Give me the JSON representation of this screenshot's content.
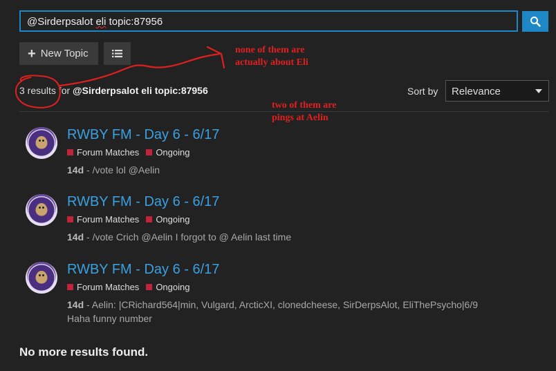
{
  "search": {
    "value_before": "@Sirderpsalot ",
    "value_squiggle": "eli",
    "value_after": " topic:87956",
    "button_icon": "search-icon"
  },
  "toolbar": {
    "new_topic_label": "New Topic",
    "new_topic_icon": "plus-icon",
    "list_icon": "list-icon"
  },
  "results": {
    "count_text": "3 results for",
    "query": "@Sirderpsalot eli topic:87956"
  },
  "sort": {
    "label": "Sort by",
    "selected": "Relevance"
  },
  "items": [
    {
      "title": "RWBY FM - Day 6 - 6/17",
      "categories": [
        "Forum Matches",
        "Ongoing"
      ],
      "date": "14d",
      "blurb_line1": "/vote lol @Aelin",
      "blurb_line2": ""
    },
    {
      "title": "RWBY FM - Day 6 - 6/17",
      "categories": [
        "Forum Matches",
        "Ongoing"
      ],
      "date": "14d",
      "blurb_line1": "/vote Crich @Aelin I forgot to @ Aelin last time",
      "blurb_line2": ""
    },
    {
      "title": "RWBY FM - Day 6 - 6/17",
      "categories": [
        "Forum Matches",
        "Ongoing"
      ],
      "date": "14d",
      "blurb_line1": "Aelin: |CRichard564|min, Vulgard, ArcticXI, clonedcheese, SirDerpsAlot, EliThePsycho|6/9",
      "blurb_line2": "Haha funny number"
    }
  ],
  "footer": {
    "no_more": "No more results found."
  },
  "annotations": {
    "note1_line1": "none of them are",
    "note1_line2": "actually about Eli",
    "note2_line1": "two of them are",
    "note2_line2": "pings at Aelin"
  },
  "colors": {
    "accent": "#1e88c7",
    "link": "#3ba0e0",
    "category": "#c0233a",
    "annotation": "#e02020"
  }
}
